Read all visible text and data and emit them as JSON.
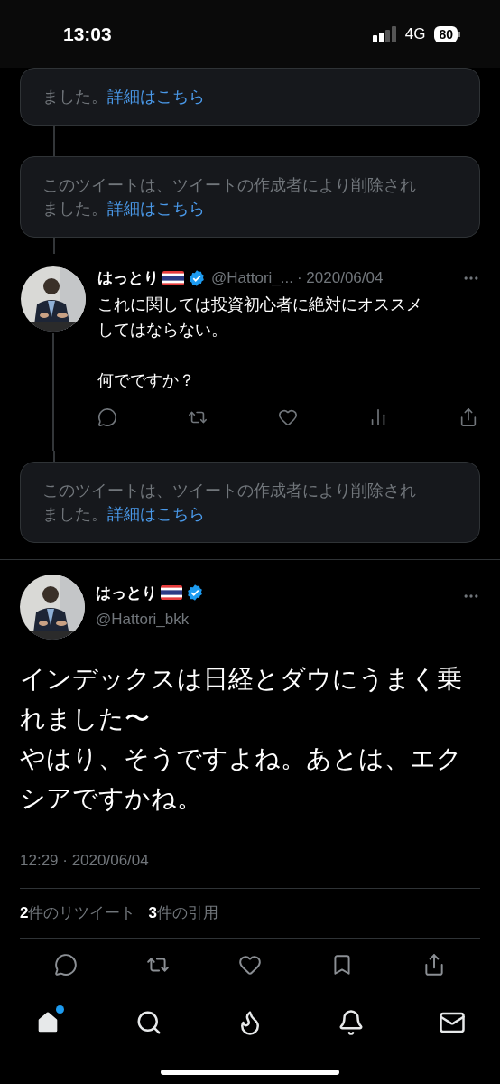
{
  "status_bar": {
    "time": "13:03",
    "network": "4G",
    "battery": "80"
  },
  "thread": [
    {
      "kind": "deleted",
      "text": "ました。",
      "link": "詳細はこちら"
    },
    {
      "kind": "deleted",
      "text": "このツイートは、ツイートの作成者により削除されました。",
      "link": "詳細はこちら"
    },
    {
      "kind": "tweet",
      "name": "はっとり",
      "handle": "@Hattori_...",
      "date": "· 2020/06/04",
      "text": [
        "これに関しては投資初心者に絶対にオススメしてはならない。",
        "何でですか？"
      ]
    },
    {
      "kind": "deleted",
      "text": "このツイートは、ツイートの作成者により削除されました。",
      "link": "詳細はこちら"
    }
  ],
  "main_tweet": {
    "name": "はっとり",
    "handle": "@Hattori_bkk",
    "text": [
      "インデックスは日経とダウにうまく乗れました〜",
      "やはり、そうですよね。あとは、エクシアですかね。"
    ],
    "timestamp": "12:29 · 2020/06/04",
    "stats": [
      "**2**件のリツイート",
      "**3**件の引用"
    ]
  },
  "nav": [
    {
      "kind": "home",
      "selected": true,
      "badge": true
    },
    {
      "kind": "search",
      "selected": false,
      "badge": false
    },
    {
      "kind": "spaces",
      "selected": false,
      "badge": false
    },
    {
      "kind": "notifications",
      "selected": false,
      "badge": false
    },
    {
      "kind": "messages",
      "selected": false,
      "badge": false
    }
  ]
}
